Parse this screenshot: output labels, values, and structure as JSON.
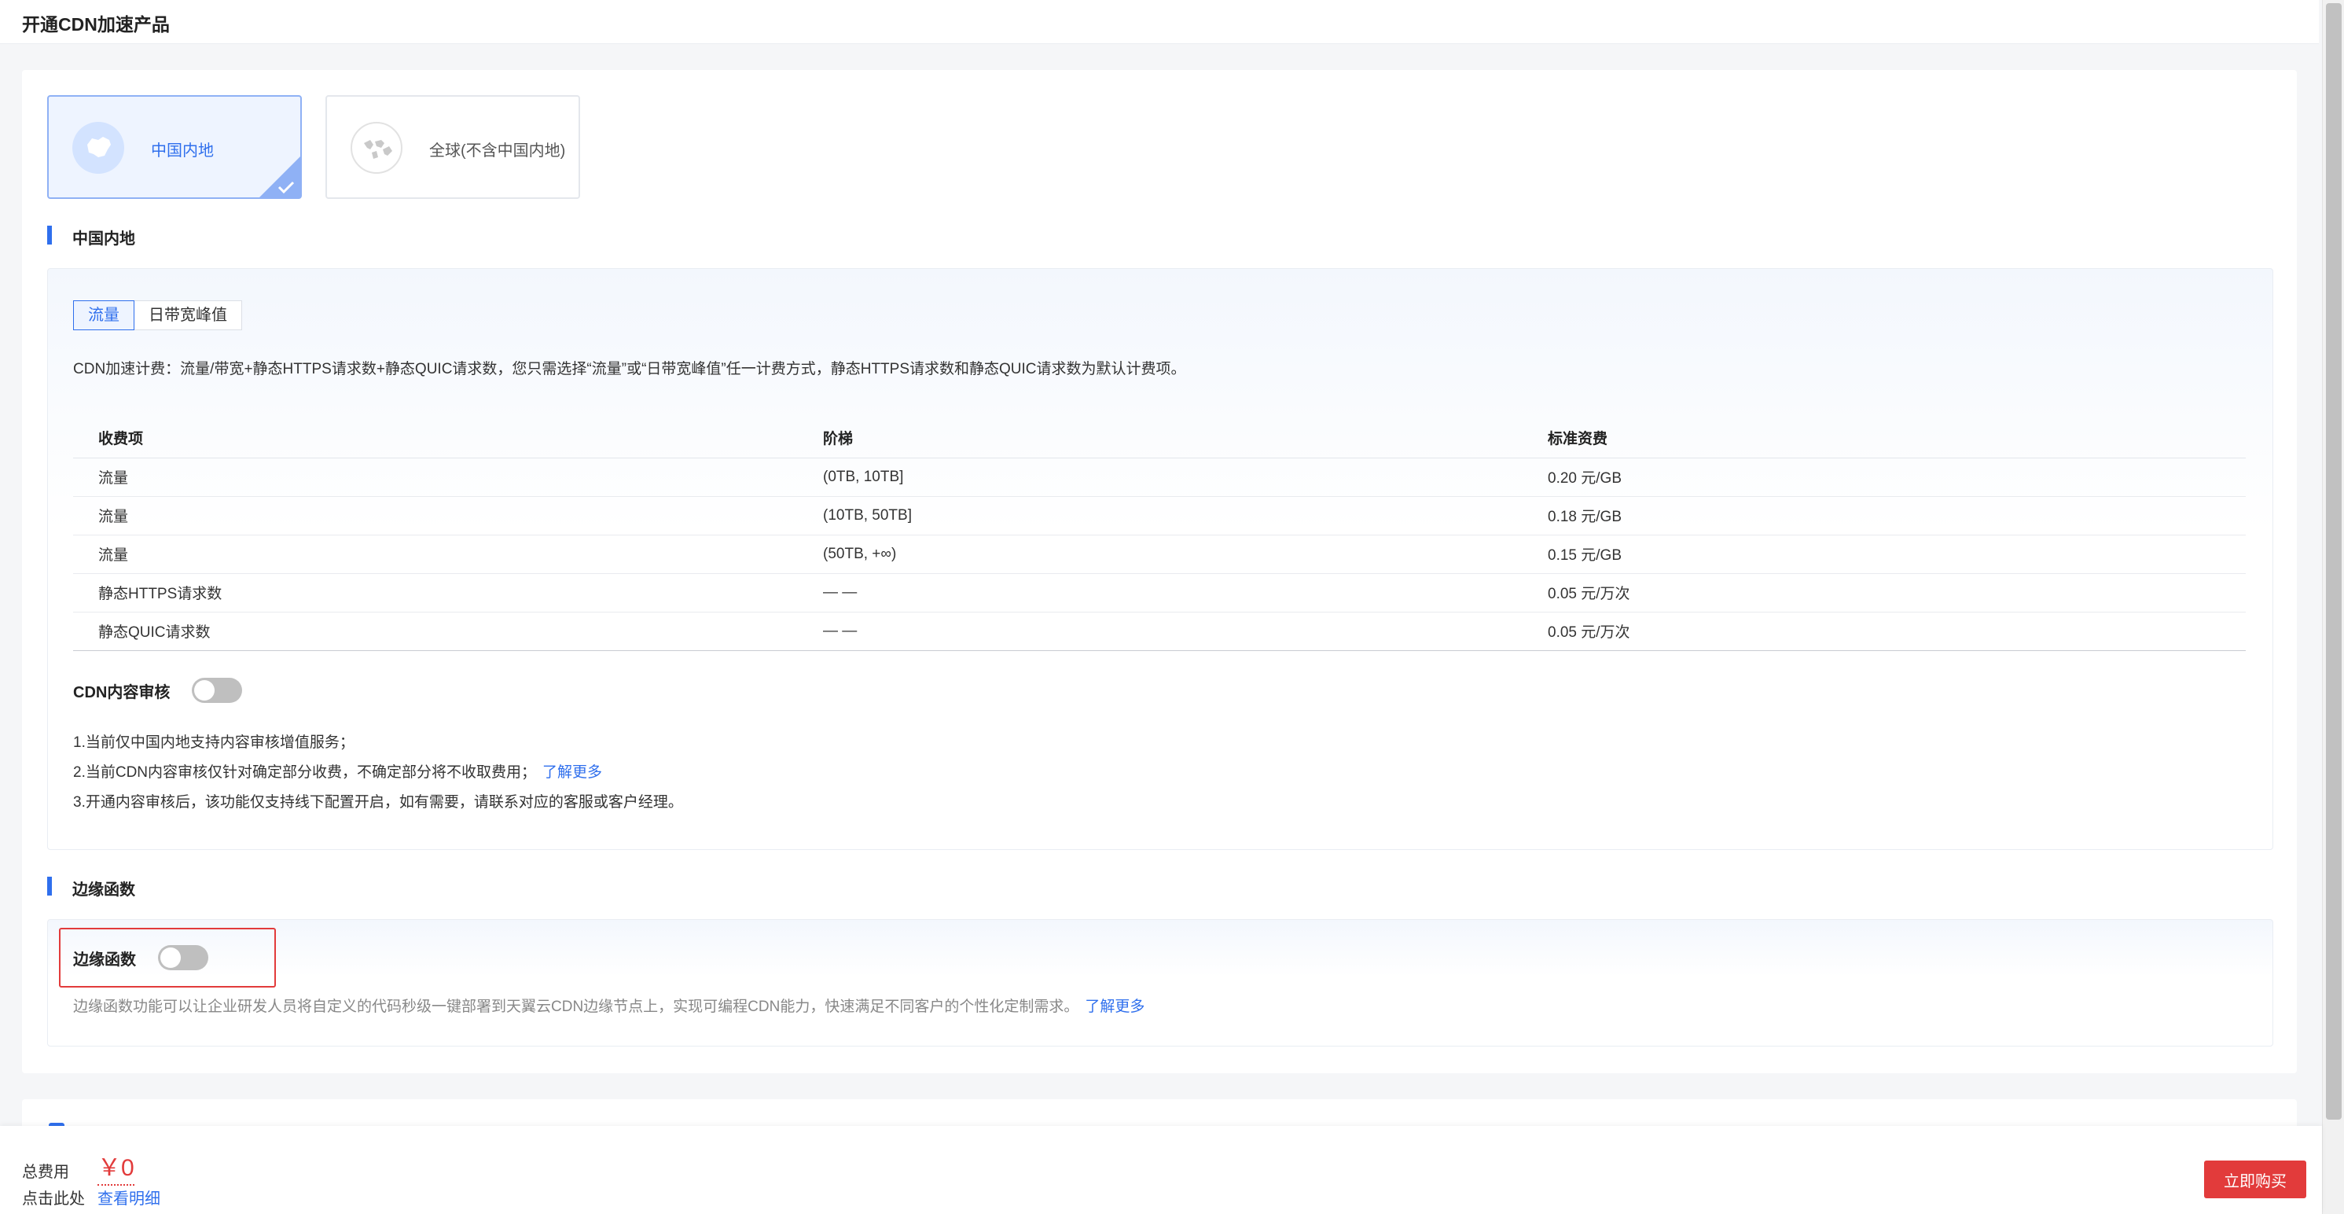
{
  "header": {
    "title": "开通CDN加速产品"
  },
  "regions": [
    {
      "label": "中国内地",
      "selected": true
    },
    {
      "label": "全球(不含中国内地)",
      "selected": false
    }
  ],
  "mainland": {
    "section_title": "中国内地",
    "tabs": [
      {
        "label": "流量",
        "active": true
      },
      {
        "label": "日带宽峰值",
        "active": false
      }
    ],
    "description": "CDN加速计费：流量/带宽+静态HTTPS请求数+静态QUIC请求数，您只需选择“流量”或“日带宽峰值”任一计费方式，静态HTTPS请求数和静态QUIC请求数为默认计费项。",
    "table": {
      "headers": [
        "收费项",
        "阶梯",
        "标准资费"
      ],
      "rows": [
        [
          "流量",
          "(0TB, 10TB]",
          "0.20 元/GB"
        ],
        [
          "流量",
          "(10TB, 50TB]",
          "0.18 元/GB"
        ],
        [
          "流量",
          "(50TB, +∞)",
          "0.15 元/GB"
        ],
        [
          "静态HTTPS请求数",
          "— —",
          "0.05 元/万次"
        ],
        [
          "静态QUIC请求数",
          "— —",
          "0.05 元/万次"
        ]
      ]
    },
    "audit": {
      "label": "CDN内容审核",
      "enabled": false,
      "notes": [
        "1.当前仅中国内地支持内容审核增值服务；",
        "2.当前CDN内容审核仅针对确定部分收费，不确定部分将不收取费用；",
        "3.开通内容审核后，该功能仅支持线下配置开启，如有需要，请联系对应的客服或客户经理。"
      ],
      "learn_more": "了解更多"
    }
  },
  "edge": {
    "section_title": "边缘函数",
    "label": "边缘函数",
    "enabled": false,
    "description": "边缘函数功能可以让企业研发人员将自定义的代码秒级一键部署到天翼云CDN边缘节点上，实现可编程CDN能力，快速满足不同客户的个性化定制需求。",
    "learn_more": "了解更多"
  },
  "footer": {
    "total_label": "总费用",
    "total_value": "￥0",
    "click_label": "点击此处",
    "detail_link": "查看明细",
    "buy_button": "立即购买"
  },
  "colors": {
    "accent": "#2f6fed",
    "danger": "#e23b3b"
  }
}
